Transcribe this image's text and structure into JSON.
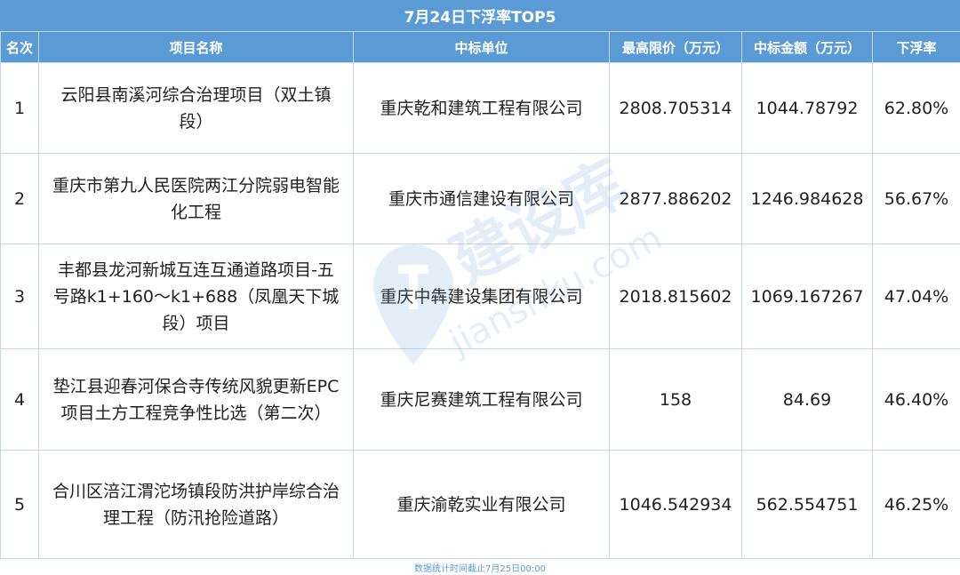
{
  "title": "7月24日下浮率TOP5",
  "headers": [
    "名次",
    "项目名称",
    "中标单位",
    "最高限价（万元）",
    "中标金额（万元）",
    "下浮率"
  ],
  "rows": [
    {
      "rank": "1",
      "project": "云阳县南溪河综合治理项目（双土镇段）",
      "winner": "重庆乾和建筑工程有限公司",
      "max_price": "2808.705314",
      "bid_amount": "1044.78792",
      "discount_rate": "62.80%"
    },
    {
      "rank": "2",
      "project": "重庆市第九人民医院两江分院弱电智能化工程",
      "winner": "重庆市通信建设有限公司",
      "max_price": "2877.886202",
      "bid_amount": "1246.984628",
      "discount_rate": "56.67%"
    },
    {
      "rank": "3",
      "project": "丰都县龙河新城互连互通道路项目-五号路k1+160～k1+688（凤凰天下城段）项目",
      "winner": "重庆中犇建设集团有限公司",
      "max_price": "2018.815602",
      "bid_amount": "1069.167267",
      "discount_rate": "47.04%"
    },
    {
      "rank": "4",
      "project": "垫江县迎春河保合寺传统风貌更新EPC项目土方工程竞争性比选（第二次）",
      "winner": "重庆尼赛建筑工程有限公司",
      "max_price": "158",
      "bid_amount": "84.69",
      "discount_rate": "46.40%"
    },
    {
      "rank": "5",
      "project": "合川区涪江渭沱场镇段防洪护岸综合治理工程（防汛抢险道路）",
      "winner": "重庆渝乾实业有限公司",
      "max_price": "1046.542934",
      "bid_amount": "562.554751",
      "discount_rate": "46.25%"
    }
  ],
  "footer": "数据统计时间截止7月25日00:00",
  "watermark": {
    "brand": "建设库",
    "domain": "jianshku.com"
  },
  "colors": {
    "header_bg": "#5b9bd5",
    "header_text": "#ffffff",
    "grid": "#c7d6e8",
    "text": "#1f1f1f"
  }
}
